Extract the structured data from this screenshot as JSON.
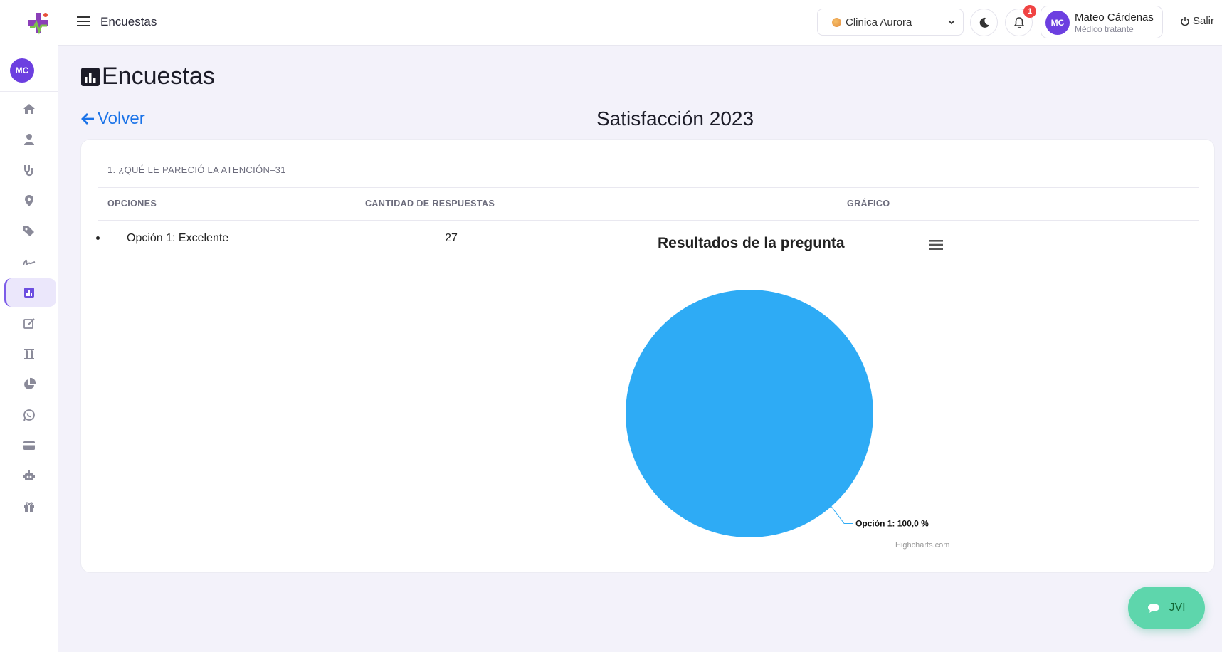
{
  "app": {
    "sidebar_avatar": "MC",
    "nav_icons": [
      "home-icon",
      "user-icon",
      "stethoscope-icon",
      "location-icon",
      "tags-icon",
      "signature-icon",
      "survey-chart-icon",
      "edit-icon",
      "lab-tubes-icon",
      "pie-chart-icon",
      "whatsapp-icon",
      "credit-card-icon",
      "robot-icon",
      "gift-icon"
    ],
    "active_nav": "survey-chart-icon"
  },
  "topbar": {
    "title": "Encuestas",
    "clinic": "Clinica Aurora",
    "notification_count": "1",
    "user": {
      "initials": "MC",
      "name": "Mateo Cárdenas",
      "role": "Médico tratante"
    },
    "logout_label": "Salir"
  },
  "page": {
    "title": "Encuestas",
    "back_label": "Volver",
    "survey_title": "Satisfacción 2023"
  },
  "card": {
    "question": "1. ¿QUÉ LE PARECIÓ LA ATENCIÓN–31",
    "headers": {
      "options": "OPCIONES",
      "count": "CANTIDAD DE RESPUESTAS",
      "chart": "GRÁFICO"
    },
    "rows": [
      {
        "label": "Opción 1: Excelente",
        "count": "27"
      }
    ]
  },
  "chart_data": {
    "type": "pie",
    "title": "Resultados de la pregunta",
    "slices": [
      {
        "name": "Opción 1",
        "value": 100.0,
        "label": "Opción 1: 100,0 %"
      }
    ],
    "colors": [
      "#2eabf5"
    ],
    "credits": "Highcharts.com"
  },
  "fab": {
    "label": "JVI"
  }
}
